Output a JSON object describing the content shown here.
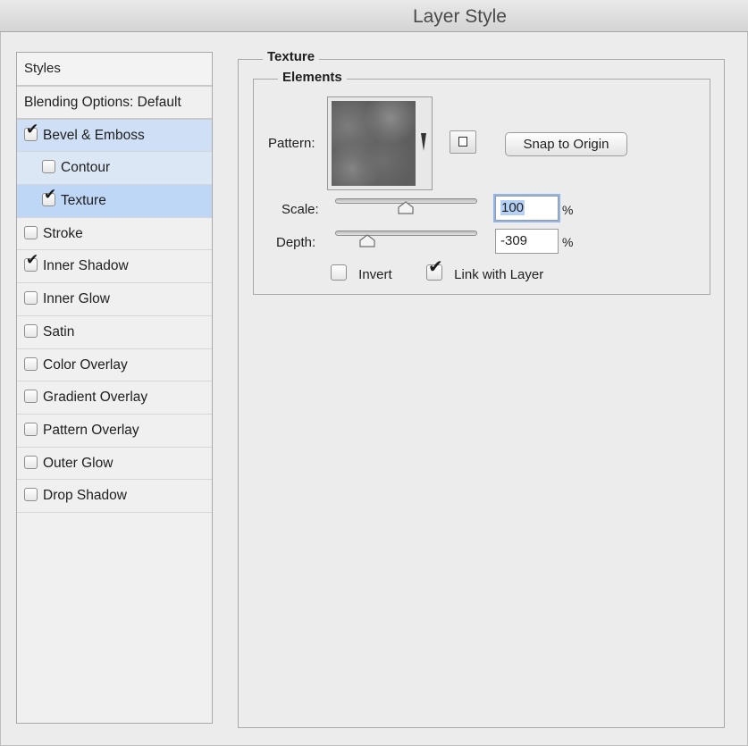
{
  "window": {
    "title": "Layer Style"
  },
  "styles_panel": {
    "header": "Styles",
    "blending_options": "Blending Options: Default",
    "items": [
      {
        "label": "Bevel & Emboss",
        "checked": true,
        "level": 0,
        "state": "selected-parent"
      },
      {
        "label": "Contour",
        "checked": false,
        "level": 1,
        "state": "selected-child"
      },
      {
        "label": "Texture",
        "checked": true,
        "level": 1,
        "state": "active"
      },
      {
        "label": "Stroke",
        "checked": false,
        "level": 0,
        "state": "none"
      },
      {
        "label": "Inner Shadow",
        "checked": true,
        "level": 0,
        "state": "none"
      },
      {
        "label": "Inner Glow",
        "checked": false,
        "level": 0,
        "state": "none"
      },
      {
        "label": "Satin",
        "checked": false,
        "level": 0,
        "state": "none"
      },
      {
        "label": "Color Overlay",
        "checked": false,
        "level": 0,
        "state": "none"
      },
      {
        "label": "Gradient Overlay",
        "checked": false,
        "level": 0,
        "state": "none"
      },
      {
        "label": "Pattern Overlay",
        "checked": false,
        "level": 0,
        "state": "none"
      },
      {
        "label": "Outer Glow",
        "checked": false,
        "level": 0,
        "state": "none"
      },
      {
        "label": "Drop Shadow",
        "checked": false,
        "level": 0,
        "state": "none"
      }
    ]
  },
  "texture": {
    "section_title": "Texture",
    "elements_title": "Elements",
    "pattern_label": "Pattern:",
    "snap_button": "Snap to Origin",
    "scale": {
      "label": "Scale:",
      "value": "100",
      "unit": "%",
      "slider_fraction": 0.5
    },
    "depth": {
      "label": "Depth:",
      "value": "-309",
      "unit": "%",
      "slider_fraction": 0.2
    },
    "invert": {
      "label": "Invert",
      "checked": false
    },
    "link_with_layer": {
      "label": "Link with Layer",
      "checked": true
    }
  },
  "colors": {
    "selection": "#bfd7f7",
    "background": "#ececec"
  }
}
